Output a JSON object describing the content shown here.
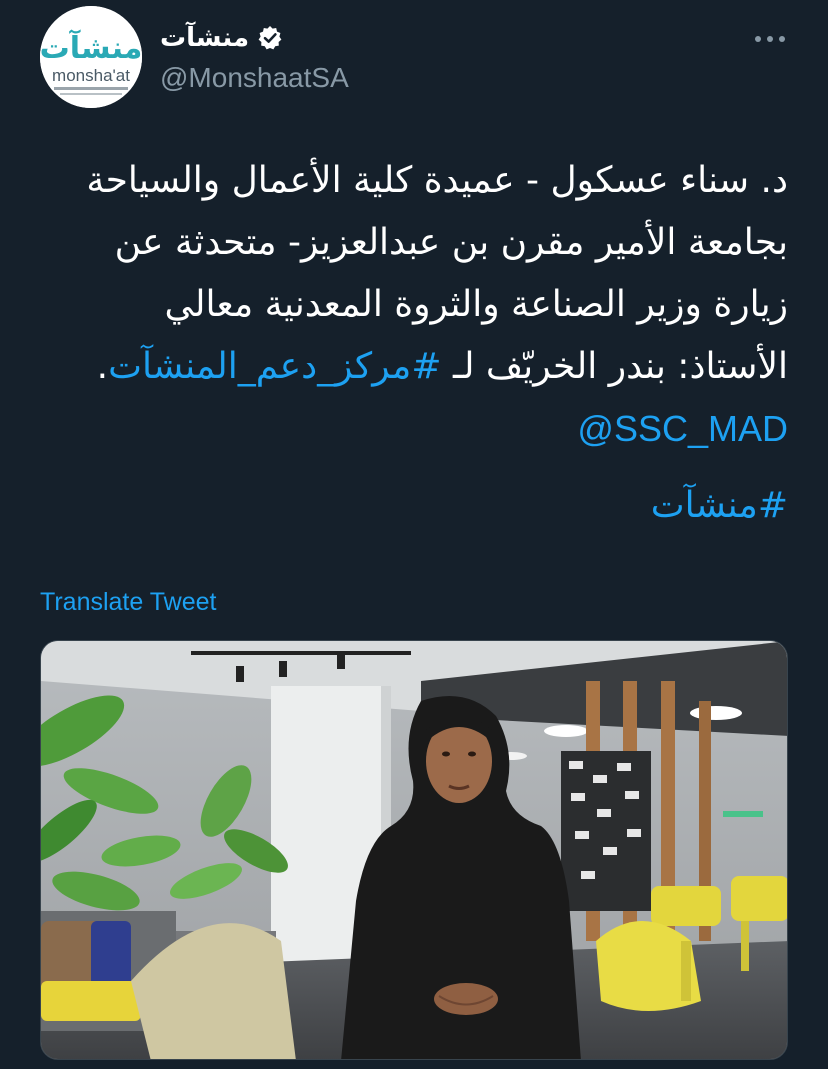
{
  "tweet": {
    "author": {
      "display_name": "منشآت",
      "handle": "@MonshaatSA",
      "verified": true,
      "avatar_logo": {
        "arabic": "منشآت",
        "latin": "monsha'at"
      }
    },
    "text_lines": [
      "د. سناء عسكول - عميدة كلية الأعمال والسياحة",
      "بجامعة الأمير مقرن بن عبدالعزيز- متحدثة عن",
      "زيارة وزير الصناعة والثروة المعدنية معالي"
    ],
    "line4_prefix": "الأستاذ: بندر الخريّف لـ ",
    "line4_hashtag": "#مركز_دعم_المنشآت",
    "line4_suffix": ".",
    "mention": "@SSC_MAD",
    "hashtag": "#منشآت",
    "translate_label": "Translate Tweet"
  },
  "icons": {
    "verified": "verified-badge-icon",
    "more": "more-options-icon"
  },
  "colors": {
    "background": "#15202b",
    "text": "#ffffff",
    "secondary_text": "#8899a6",
    "link": "#1da1f2",
    "border": "#38444d"
  }
}
